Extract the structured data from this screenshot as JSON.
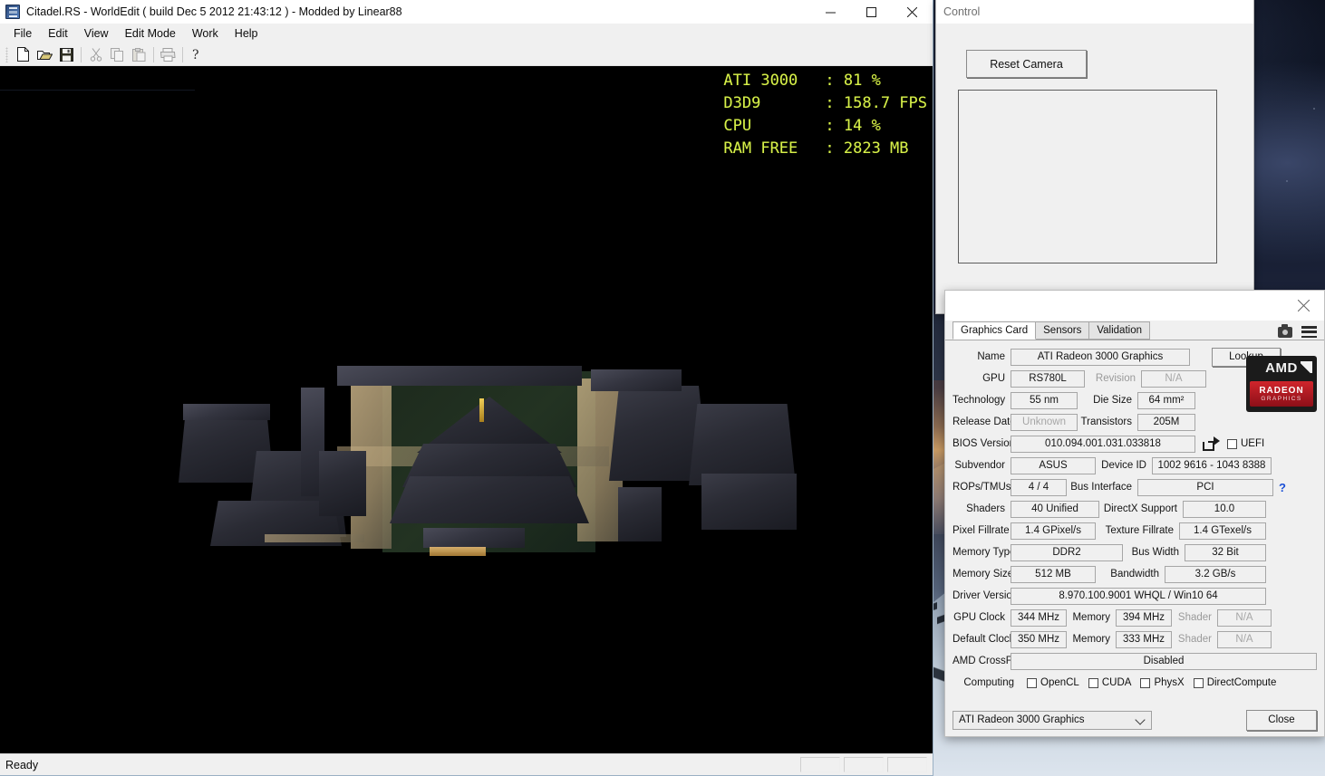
{
  "worldedit": {
    "title": "Citadel.RS - WorldEdit ( build Dec  5 2012 21:43:12 ) - Modded by Linear88",
    "icon": "app-icon",
    "window_buttons": [
      {
        "name": "minimize",
        "glyph": "—"
      },
      {
        "name": "maximize",
        "glyph": "□"
      },
      {
        "name": "close",
        "glyph": "✕"
      }
    ],
    "menu": [
      "File",
      "Edit",
      "View",
      "Edit Mode",
      "Work",
      "Help"
    ],
    "toolbar": [
      {
        "name": "new-icon",
        "enabled": true
      },
      {
        "name": "open-icon",
        "enabled": true
      },
      {
        "name": "save-icon",
        "enabled": true
      },
      {
        "name": "cut-icon",
        "enabled": false
      },
      {
        "name": "copy-icon",
        "enabled": false
      },
      {
        "name": "paste-icon",
        "enabled": false
      },
      {
        "name": "print-icon",
        "enabled": false
      },
      {
        "name": "help-icon",
        "enabled": true
      }
    ],
    "hud": [
      {
        "key": "ATI 3000",
        "value": "81 %"
      },
      {
        "key": "D3D9",
        "value": "158.7 FPS"
      },
      {
        "key": "CPU",
        "value": "14 %"
      },
      {
        "key": "RAM FREE",
        "value": "2823 MB"
      }
    ],
    "hud_color": "#d8f04a",
    "status": "Ready",
    "status_panes": 3
  },
  "control": {
    "title": "Control",
    "reset_camera": "Reset Camera"
  },
  "gpuz": {
    "tabs": [
      {
        "label": "Graphics Card",
        "active": true
      },
      {
        "label": "Sensors",
        "active": false
      },
      {
        "label": "Validation",
        "active": false
      }
    ],
    "lookup_button": "Lookup",
    "logo": {
      "top": "AMD",
      "line1": "RADEON",
      "line2": "GRAPHICS"
    },
    "fields": {
      "name_label": "Name",
      "name_value": "ATI Radeon 3000 Graphics",
      "gpu_label": "GPU",
      "gpu_value": "RS780L",
      "revision_label": "Revision",
      "revision_value": "N/A",
      "technology_label": "Technology",
      "technology_value": "55 nm",
      "die_size_label": "Die Size",
      "die_size_value": "64 mm²",
      "release_date_label": "Release Date",
      "release_date_value": "Unknown",
      "transistors_label": "Transistors",
      "transistors_value": "205M",
      "bios_label": "BIOS Version",
      "bios_value": "010.094.001.031.033818",
      "uefi_label": "UEFI",
      "subvendor_label": "Subvendor",
      "subvendor_value": "ASUS",
      "device_id_label": "Device ID",
      "device_id_value": "1002 9616 - 1043 8388",
      "rops_label": "ROPs/TMUs",
      "rops_value": "4 / 4",
      "bus_interface_label": "Bus Interface",
      "bus_interface_value": "PCI",
      "help_glyph": "?",
      "shaders_label": "Shaders",
      "shaders_value": "40 Unified",
      "directx_label": "DirectX Support",
      "directx_value": "10.0",
      "pixel_fillrate_label": "Pixel Fillrate",
      "pixel_fillrate_value": "1.4 GPixel/s",
      "texture_fillrate_label": "Texture Fillrate",
      "texture_fillrate_value": "1.4 GTexel/s",
      "memory_type_label": "Memory Type",
      "memory_type_value": "DDR2",
      "bus_width_label": "Bus Width",
      "bus_width_value": "32 Bit",
      "memory_size_label": "Memory Size",
      "memory_size_value": "512 MB",
      "bandwidth_label": "Bandwidth",
      "bandwidth_value": "3.2 GB/s",
      "driver_label": "Driver Version",
      "driver_value": "8.970.100.9001 WHQL / Win10 64",
      "gpu_clock_label": "GPU Clock",
      "gpu_clock_value": "344 MHz",
      "gpu_memory_label": "Memory",
      "gpu_memory_value": "394 MHz",
      "gpu_shader_label": "Shader",
      "gpu_shader_value": "N/A",
      "default_clock_label": "Default Clock",
      "default_clock_value": "350 MHz",
      "default_memory_label": "Memory",
      "default_memory_value": "333 MHz",
      "default_shader_label": "Shader",
      "default_shader_value": "N/A",
      "crossfire_label": "AMD CrossFire",
      "crossfire_value": "Disabled",
      "computing_label": "Computing"
    },
    "computing": [
      {
        "label": "OpenCL",
        "checked": false
      },
      {
        "label": "CUDA",
        "checked": false
      },
      {
        "label": "PhysX",
        "checked": false
      },
      {
        "label": "DirectCompute",
        "checked": false
      }
    ],
    "footer": {
      "selected_card": "ATI Radeon 3000 Graphics",
      "close_button": "Close"
    }
  }
}
